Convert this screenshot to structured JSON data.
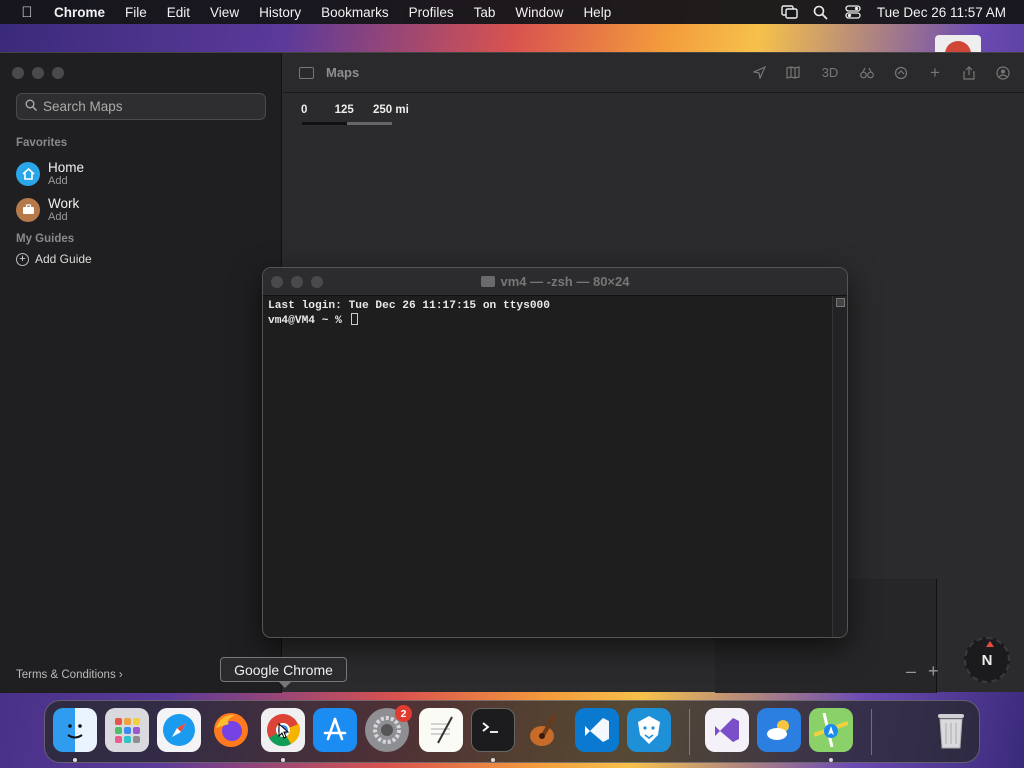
{
  "menubar": {
    "app_name": "Chrome",
    "items": [
      "File",
      "Edit",
      "View",
      "History",
      "Bookmarks",
      "Profiles",
      "Tab",
      "Window",
      "Help"
    ],
    "datetime": "Tue Dec 26  11:57 AM"
  },
  "maps": {
    "toolbar_title": "Maps",
    "tool_3d": "3D",
    "search_placeholder": "Search Maps",
    "favorites_label": "Favorites",
    "home_title": "Home",
    "home_sub": "Add",
    "work_title": "Work",
    "work_sub": "Add",
    "guides_label": "My Guides",
    "add_guide": "Add Guide",
    "terms": "Terms & Conditions",
    "scale": {
      "s0": "0",
      "s1": "125",
      "s2": "250 mi"
    },
    "compass": "N",
    "zoom_out": "–",
    "zoom_in": "+"
  },
  "terminal": {
    "title": "vm4 — -zsh — 80×24",
    "line1": "Last login: Tue Dec 26 11:17:15 on ttys000",
    "prompt": "vm4@VM4 ~ % "
  },
  "tooltip": "Google Chrome",
  "dock": {
    "settings_badge": "2",
    "apps": [
      "finder-icon",
      "launchpad-icon",
      "safari-icon",
      "firefox-icon",
      "chrome-icon",
      "app-store-icon",
      "system-settings-icon",
      "textedit-icon",
      "terminal-icon",
      "instruments-icon",
      "vscode-icon",
      "lion-app-icon",
      "visual-studio-icon",
      "weather-icon",
      "maps-icon",
      "trash-icon"
    ]
  },
  "colors": {
    "accent_blue": "#1a9bf0",
    "badge_red": "#e23b30",
    "home_icon": "#2aa6e8",
    "work_icon": "#b5794a"
  }
}
